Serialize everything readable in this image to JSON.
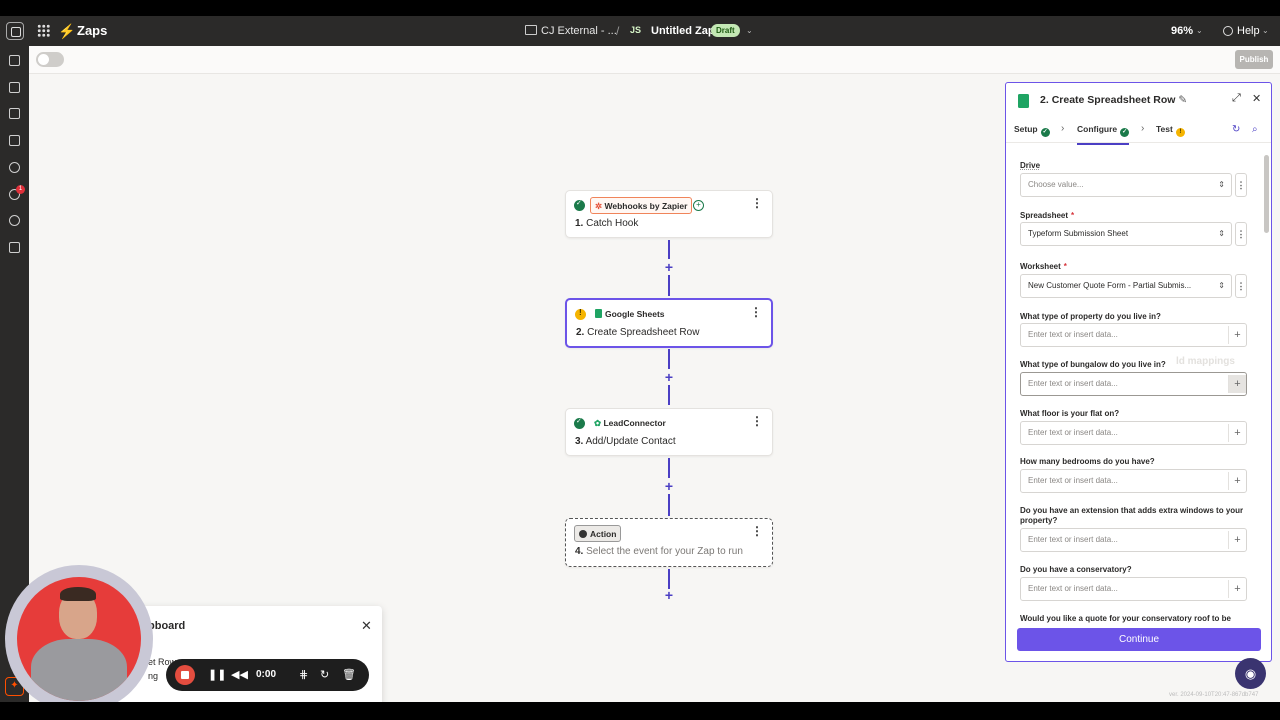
{
  "app": {
    "name": "Zaps"
  },
  "header": {
    "folder": "CJ External - ...",
    "separator": "/",
    "owner_initials": "JS",
    "zap_title": "Untitled Zap",
    "status_badge": "Draft",
    "zoom": "96%",
    "help": "Help"
  },
  "subbar": {
    "publish": "Publish"
  },
  "rail": {
    "notification_count": "1"
  },
  "steps": [
    {
      "app": "Webhooks by Zapier",
      "number": "1.",
      "title": "Catch Hook",
      "status": "ok"
    },
    {
      "app": "Google Sheets",
      "number": "2.",
      "title": "Create Spreadsheet Row",
      "status": "warning"
    },
    {
      "app": "LeadConnector",
      "number": "3.",
      "title": "Add/Update Contact",
      "status": "ok"
    },
    {
      "app": "Action",
      "number": "4.",
      "title": "Select the event for your Zap to run",
      "status": "empty"
    }
  ],
  "panel": {
    "number": "2.",
    "title": "Create Spreadsheet Row",
    "tabs": [
      "Setup",
      "Configure",
      "Test"
    ],
    "fields": [
      {
        "label": "Drive",
        "required": false,
        "value": "Choose value...",
        "placeholder": true
      },
      {
        "label": "Spreadsheet",
        "required": true,
        "value": "Typeform Submission Sheet",
        "placeholder": false
      },
      {
        "label": "Worksheet",
        "required": true,
        "value": "New Customer Quote Form - Partial Submis...",
        "placeholder": false
      },
      {
        "label": "What type of property do you live in?",
        "value": "Enter text or insert data..."
      },
      {
        "label": "What type of bungalow do you live in?",
        "value": "Enter text or insert data..."
      },
      {
        "label": "What floor is your flat on?",
        "value": "Enter text or insert data..."
      },
      {
        "label": "How many bedrooms do you have?",
        "value": "Enter text or insert data..."
      },
      {
        "label": "Do you have an extension that adds extra windows to your property?",
        "value": "Enter text or insert data..."
      },
      {
        "label": "Do you have a conservatory?",
        "value": "Enter text or insert data..."
      },
      {
        "label": "Would you like a quote for your conservatory roof to be"
      }
    ],
    "ghost_hint": "ld mappings",
    "continue": "Continue"
  },
  "recorder": {
    "card_title": "pboard",
    "card_line1": "et Row",
    "card_line2": "ng",
    "time": "0:00"
  },
  "version": "ver. 2024-09-10T20:47-867db747",
  "colors": {
    "accent": "#6c54e8",
    "brand": "#ff4f00",
    "connector": "#4b3fc4",
    "topbar": "#2b2a29"
  }
}
